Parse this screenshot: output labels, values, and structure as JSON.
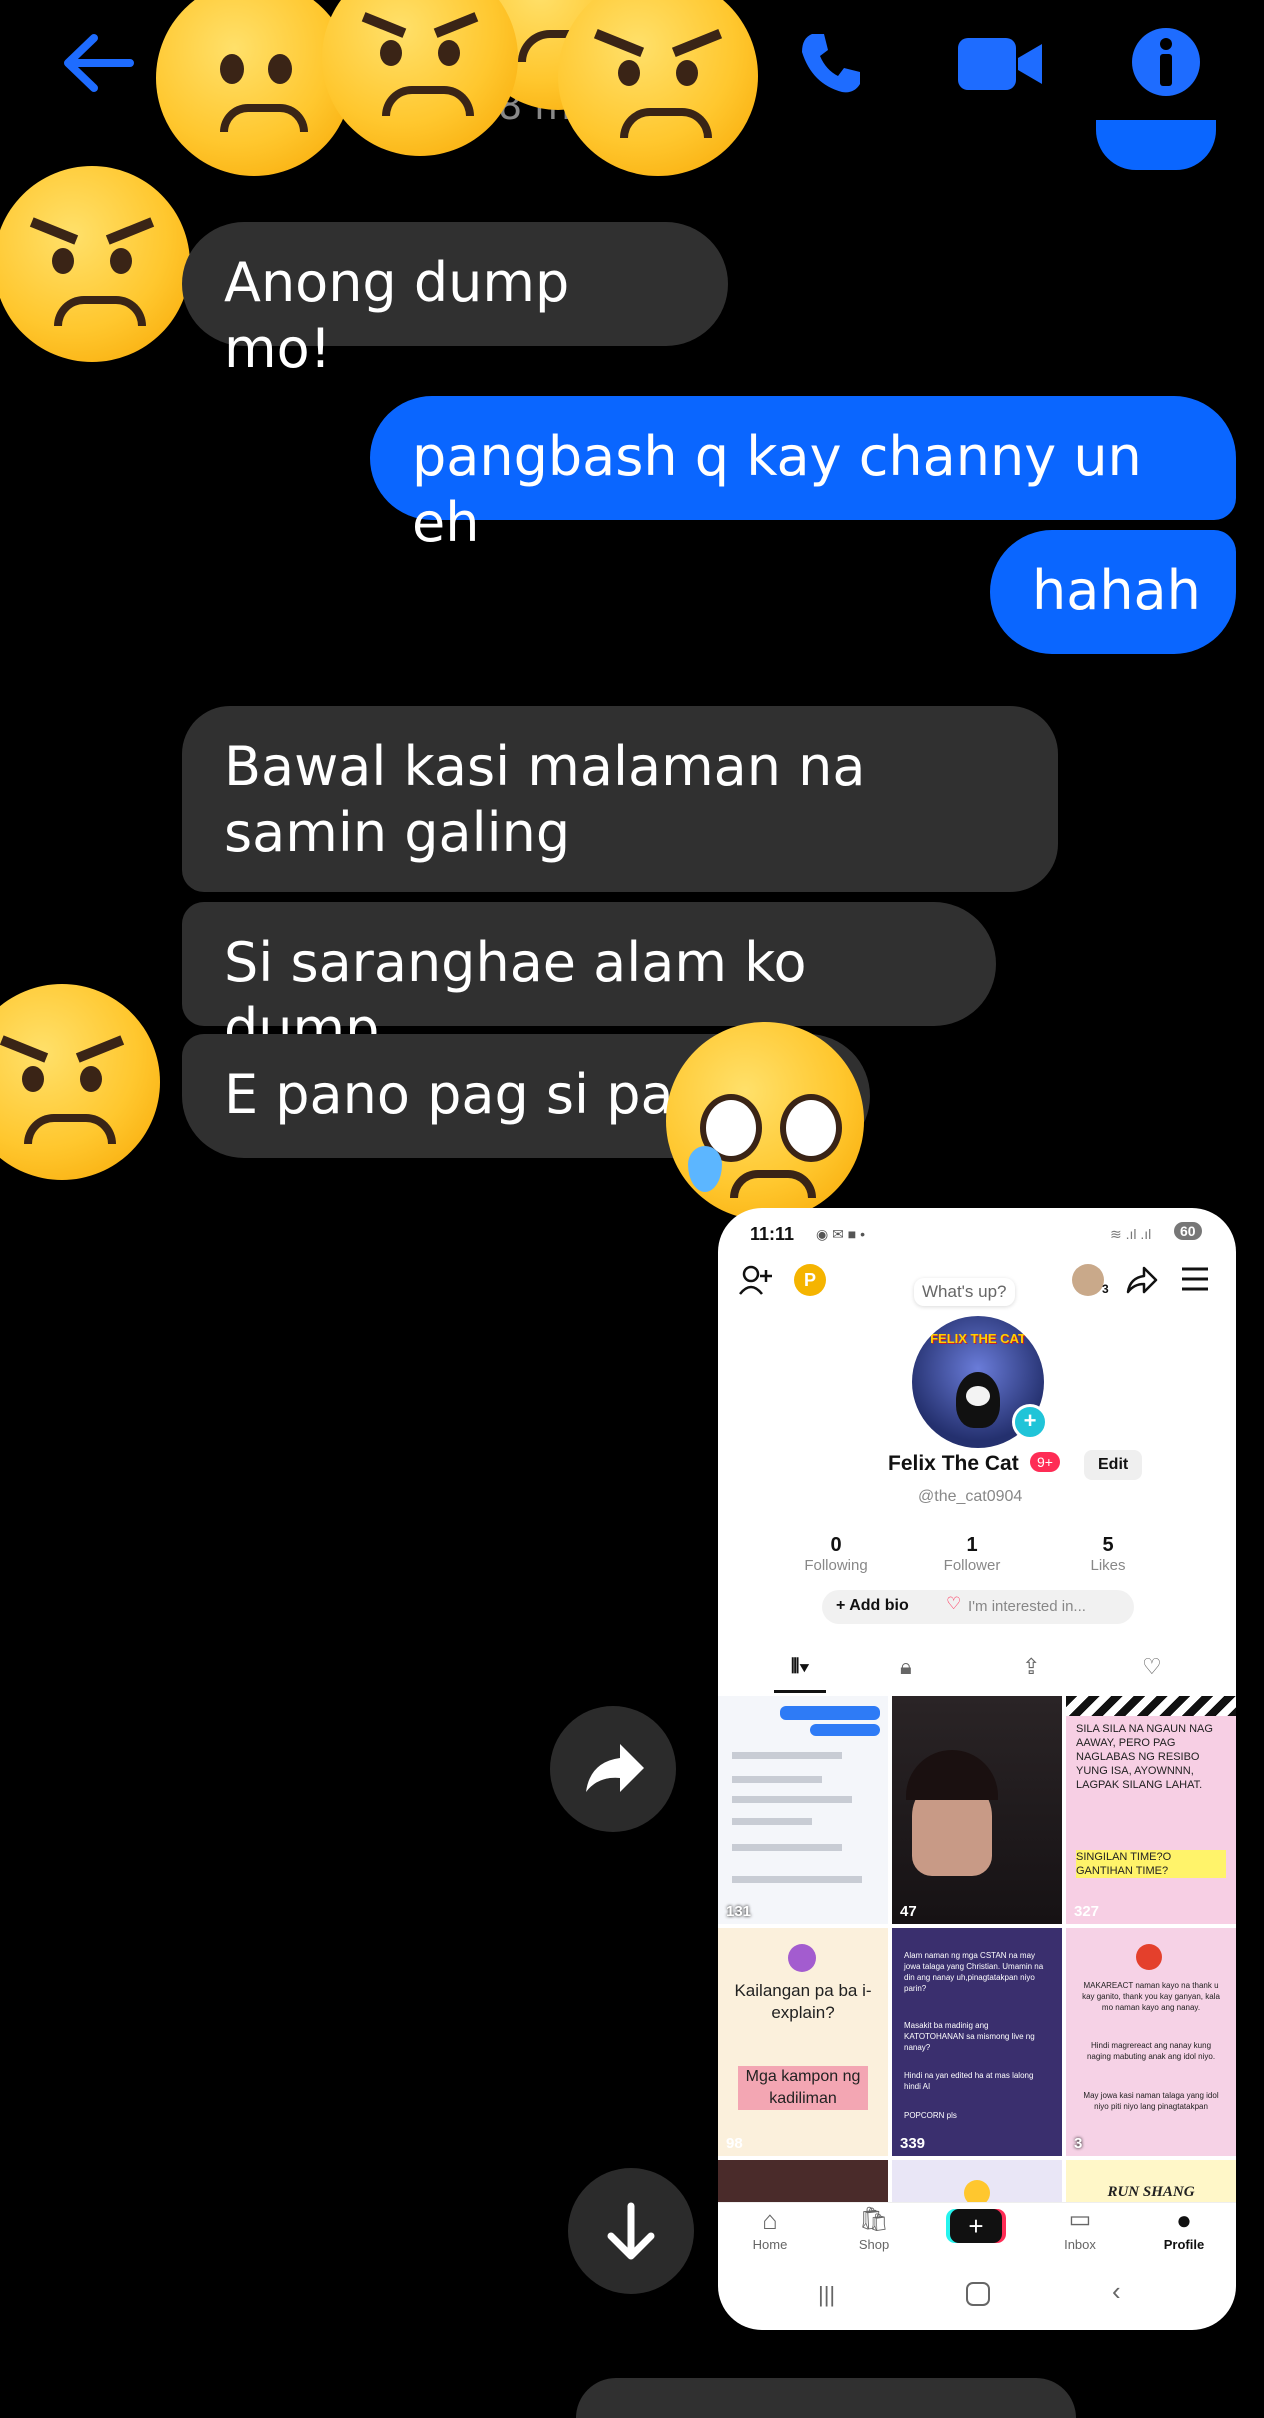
{
  "header": {
    "timestamp_partial": "8 m",
    "back_icon": "arrow-left-icon",
    "call_icon": "phone-icon",
    "video_icon": "video-camera-icon",
    "info_icon": "info-icon",
    "accent": "#1e6cff"
  },
  "messages": [
    {
      "side": "in",
      "text": "Anong dump mo!"
    },
    {
      "side": "out",
      "text": "pangbash q kay channy un eh"
    },
    {
      "side": "out",
      "text": "hahah"
    },
    {
      "side": "in",
      "text": "Bawal kasi malaman na samin galing"
    },
    {
      "side": "in",
      "text": "Si saranghae alam ko dump"
    },
    {
      "side": "in",
      "text": "E pano pag si pa"
    }
  ],
  "colors": {
    "incoming_bubble": "#303030",
    "outgoing_bubble": "#0a66ff",
    "background": "#000000"
  },
  "reactions": [
    "frowning-face",
    "angry-face",
    "angry-face",
    "angry-face",
    "angry-face",
    "angry-face",
    "sad-tear-face"
  ],
  "actions": {
    "forward_icon": "share-arrow-icon",
    "scroll_down_icon": "arrow-down-icon"
  },
  "screenshot": {
    "status": {
      "time": "11:11",
      "battery": "60"
    },
    "whats_up": "What's up?",
    "friends_count": "3",
    "coin_label": "P",
    "profile": {
      "name": "Felix The Cat",
      "badge": "9+",
      "edit": "Edit",
      "handle": "@the_cat0904",
      "avatar_text": "FELIX THE CAT"
    },
    "stats": [
      {
        "value": "0",
        "label": "Following"
      },
      {
        "value": "1",
        "label": "Follower"
      },
      {
        "value": "5",
        "label": "Likes"
      }
    ],
    "add_bio": "+ Add bio",
    "interested": "I'm interested in...",
    "videos": [
      {
        "views": "131",
        "caption": ""
      },
      {
        "views": "47",
        "caption": ""
      },
      {
        "views": "327",
        "caption": "SILA SILA NA NGAUN NAG AAWAY, PERO PAG NAGLABAS NG RESIBO YUNG ISA, AYOWNNN, LAGPAK SILANG LAHAT.",
        "caption2": "SINGILAN TIME?O GANTIHAN TIME?"
      },
      {
        "views": "98",
        "caption": "Kailangan pa ba i-explain?",
        "caption2": "Mga kampon ng kadiliman"
      },
      {
        "views": "339",
        "caption": "Alam naman ng mga CSTAN na may jowa talaga yang Christian. Umamin na din ang nanay uh,pinagtatakpan niyo parin?",
        "caption2": "Masakit ba madinig ang KATOTOHANAN sa mismong live ng nanay?",
        "caption3": "Hindi na yan edited ha at mas lalong hindi AI",
        "caption4": "POPCORN pls"
      },
      {
        "views": "3",
        "caption": "MAKAREACT naman kayo na thank u kay ganito, thank you kay ganyan, kala mo naman kayo ang nanay.",
        "caption2": "Hindi magrereact ang nanay kung naging mabuting anak ang idol niyo.",
        "caption3": "May jowa kasi naman talaga yang idol niyo piti niyo lang pinagtatakpan"
      },
      {
        "views": "",
        "caption": ""
      },
      {
        "views": "",
        "caption": ""
      },
      {
        "views": "",
        "caption": "RUN SHANG"
      }
    ],
    "nav": [
      {
        "label": "Home"
      },
      {
        "label": "Shop"
      },
      {
        "label": "+"
      },
      {
        "label": "Inbox"
      },
      {
        "label": "Profile"
      }
    ]
  }
}
